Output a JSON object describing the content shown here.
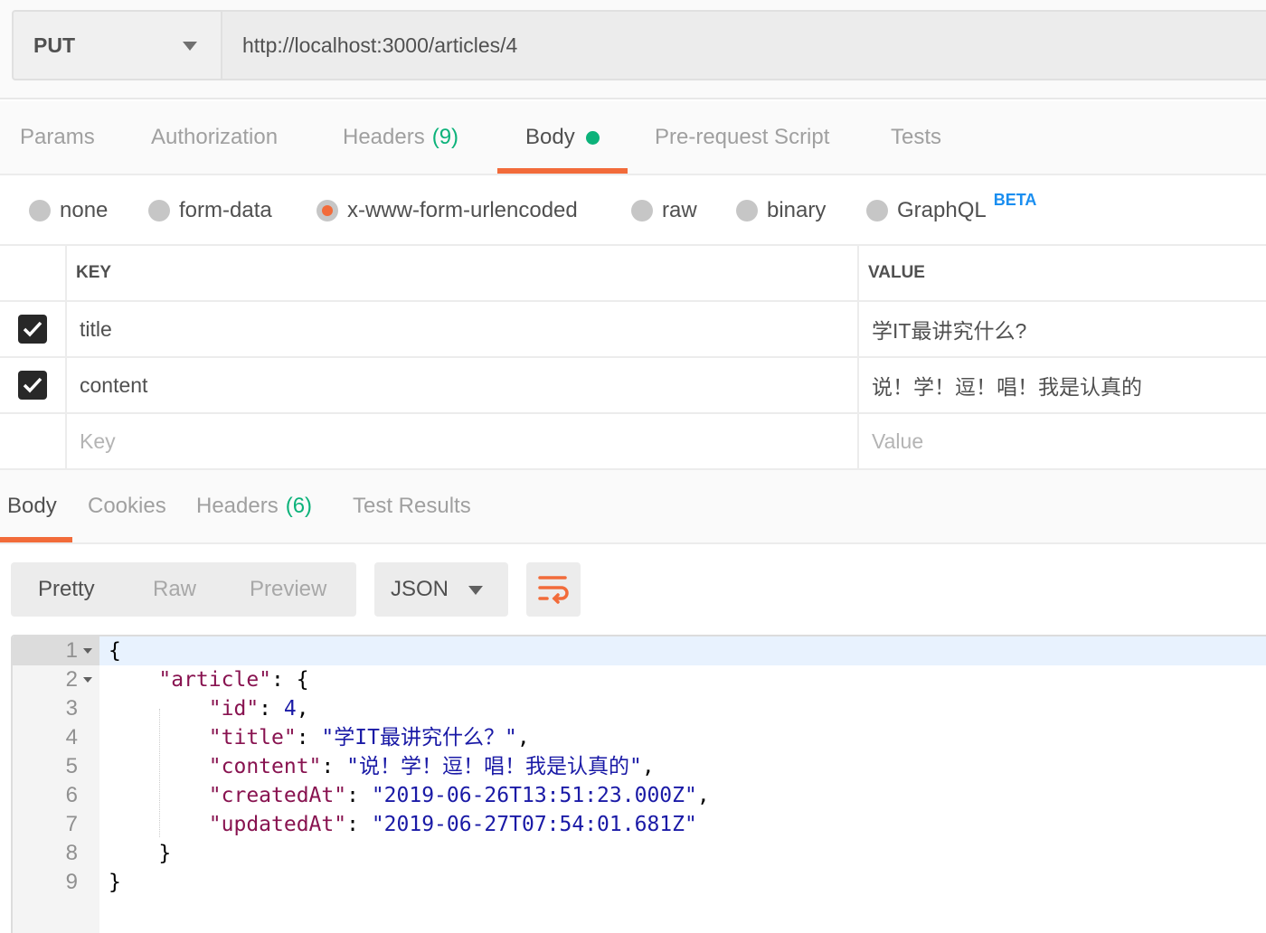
{
  "request": {
    "method": "PUT",
    "url": "http://localhost:3000/articles/4"
  },
  "request_tabs": [
    {
      "label": "Params"
    },
    {
      "label": "Authorization"
    },
    {
      "label": "Headers",
      "count": "(9)"
    },
    {
      "label": "Body",
      "active": true
    },
    {
      "label": "Pre-request Script"
    },
    {
      "label": "Tests"
    }
  ],
  "body_types": [
    {
      "label": "none"
    },
    {
      "label": "form-data"
    },
    {
      "label": "x-www-form-urlencoded",
      "selected": true
    },
    {
      "label": "raw"
    },
    {
      "label": "binary"
    },
    {
      "label": "GraphQL",
      "badge": "BETA"
    }
  ],
  "params_table": {
    "headers": {
      "key": "KEY",
      "value": "VALUE"
    },
    "rows": [
      {
        "checked": true,
        "key": "title",
        "value": "学IT最讲究什么?"
      },
      {
        "checked": true,
        "key": "content",
        "value": "说！学！逗！唱！我是认真的"
      }
    ],
    "placeholder": {
      "key": "Key",
      "value": "Value"
    }
  },
  "response_tabs": [
    {
      "label": "Body",
      "active": true
    },
    {
      "label": "Cookies"
    },
    {
      "label": "Headers",
      "count": "(6)"
    },
    {
      "label": "Test Results"
    }
  ],
  "response_toolbar": {
    "views": [
      "Pretty",
      "Raw",
      "Preview"
    ],
    "active_view": "Pretty",
    "format": "JSON",
    "wrap_icon": "wrap-lines-icon"
  },
  "code_lines": [
    [
      [
        "p",
        "{"
      ]
    ],
    [
      [
        "p",
        "    "
      ],
      [
        "k",
        "\"article\""
      ],
      [
        "p",
        ": {"
      ]
    ],
    [
      [
        "p",
        "        "
      ],
      [
        "k",
        "\"id\""
      ],
      [
        "p",
        ": "
      ],
      [
        "n",
        "4"
      ],
      [
        "p",
        ","
      ]
    ],
    [
      [
        "p",
        "        "
      ],
      [
        "k",
        "\"title\""
      ],
      [
        "p",
        ": "
      ],
      [
        "s",
        "\"学IT最讲究什么？\""
      ],
      [
        "p",
        ","
      ]
    ],
    [
      [
        "p",
        "        "
      ],
      [
        "k",
        "\"content\""
      ],
      [
        "p",
        ": "
      ],
      [
        "s",
        "\"说！学！逗！唱！我是认真的\""
      ],
      [
        "p",
        ","
      ]
    ],
    [
      [
        "p",
        "        "
      ],
      [
        "k",
        "\"createdAt\""
      ],
      [
        "p",
        ": "
      ],
      [
        "s",
        "\"2019-06-26T13:51:23.000Z\""
      ],
      [
        "p",
        ","
      ]
    ],
    [
      [
        "p",
        "        "
      ],
      [
        "k",
        "\"updatedAt\""
      ],
      [
        "p",
        ": "
      ],
      [
        "s",
        "\"2019-06-27T07:54:01.681Z\""
      ]
    ],
    [
      [
        "p",
        "    }"
      ]
    ],
    [
      [
        "p",
        "}"
      ]
    ]
  ],
  "colors": {
    "accent": "#f26b3a",
    "count_green": "#0cb27a",
    "beta_blue": "#1a8ef0",
    "json_key": "#881350",
    "json_value": "#1a1aa6"
  }
}
